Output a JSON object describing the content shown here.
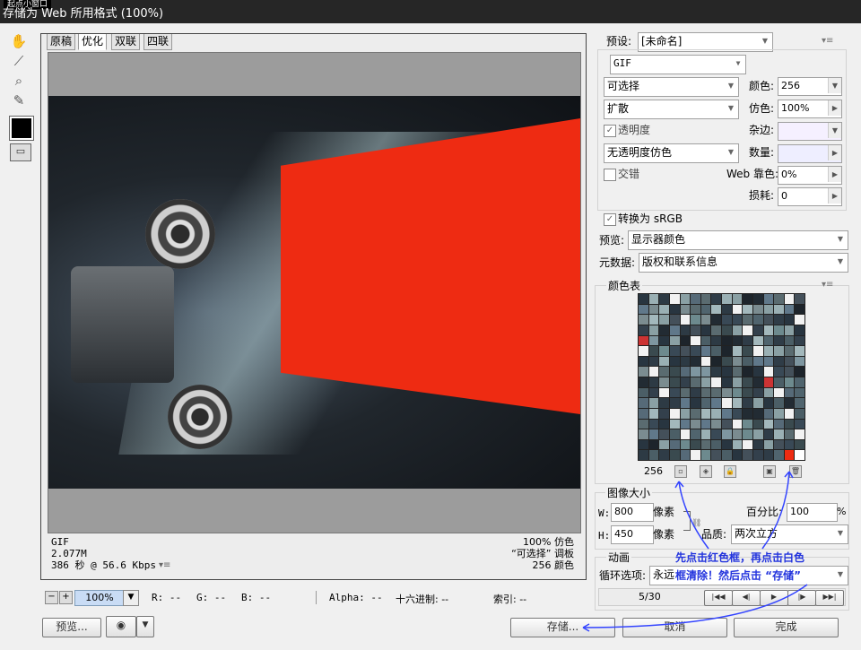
{
  "window": {
    "small_label": "起点小窗口",
    "title": "存储为 Web 所用格式 (100%)"
  },
  "tools": [
    {
      "name": "hand-tool-icon",
      "glyph": "✋"
    },
    {
      "name": "slice-select-tool-icon",
      "glyph": "⟋"
    },
    {
      "name": "zoom-tool-icon",
      "glyph": "🔍"
    },
    {
      "name": "eyedropper-tool-icon",
      "glyph": "✎"
    }
  ],
  "tabs": [
    "原稿",
    "优化",
    "双联",
    "四联"
  ],
  "image_info": {
    "left": [
      "GIF",
      "2.077M",
      "386 秒 @ 56.6 Kbps"
    ],
    "right": [
      "100% 仿色",
      "“可选择” 调板",
      "256 颜色"
    ]
  },
  "statusbar": {
    "zoom": "100%",
    "r": "R: --",
    "g": "G: --",
    "b": "B: --",
    "alpha": "Alpha: --",
    "hex": "十六进制: --",
    "index": "索引: --"
  },
  "buttons": {
    "preview": "预览...",
    "save": "存储...",
    "cancel": "取消",
    "done": "完成"
  },
  "settings": {
    "preset_label": "预设:",
    "preset_value": "[未命名]",
    "format": "GIF",
    "reduction": "可选择",
    "dither_algo": "扩散",
    "transparency_label": "透明度",
    "transparency_dither": "无透明度仿色",
    "interlaced_label": "交错",
    "colors_label": "颜色:",
    "colors_value": "256",
    "dither_label": "仿色:",
    "dither_value": "100%",
    "matte_label": "杂边:",
    "amount_label": "数量:",
    "websnap_label": "Web 靠色:",
    "websnap_value": "0%",
    "lossy_label": "损耗:",
    "lossy_value": "0",
    "convert_srgb": "转换为 sRGB",
    "preview_label": "预览:",
    "preview_value": "显示器颜色",
    "metadata_label": "元数据:",
    "metadata_value": "版权和联系信息"
  },
  "color_table": {
    "title": "颜色表",
    "count": "256"
  },
  "image_size": {
    "title": "图像大小",
    "w_label": "W:",
    "w_value": "800",
    "h_label": "H:",
    "h_value": "450",
    "unit": "像素",
    "percent_label": "百分比:",
    "percent_value": "100",
    "percent_unit": "%",
    "quality_label": "品质:",
    "quality_value": "两次立方"
  },
  "animation": {
    "title": "动画",
    "loop_label": "循环选项:",
    "loop_value": "永远",
    "frame": "5/30"
  },
  "annotation": {
    "line1": "先点击红色框，再点击白色",
    "line2": "框清除！然后点击 “存储”"
  },
  "palette_colors": [
    "#3a4a4f",
    "#5a6b70",
    "#2d3a44",
    "#7b8c90",
    "#44505a",
    "#1d242b",
    "#6d8a8e",
    "#394956",
    "#8aa0a4",
    "#283540",
    "#566a78",
    "#9ab0b4",
    "#33404c",
    "#60788a",
    "#4b5e66",
    "#222b33",
    "#7e96a0",
    "#2f3c47",
    "#50646e",
    "#a3b8bc"
  ]
}
